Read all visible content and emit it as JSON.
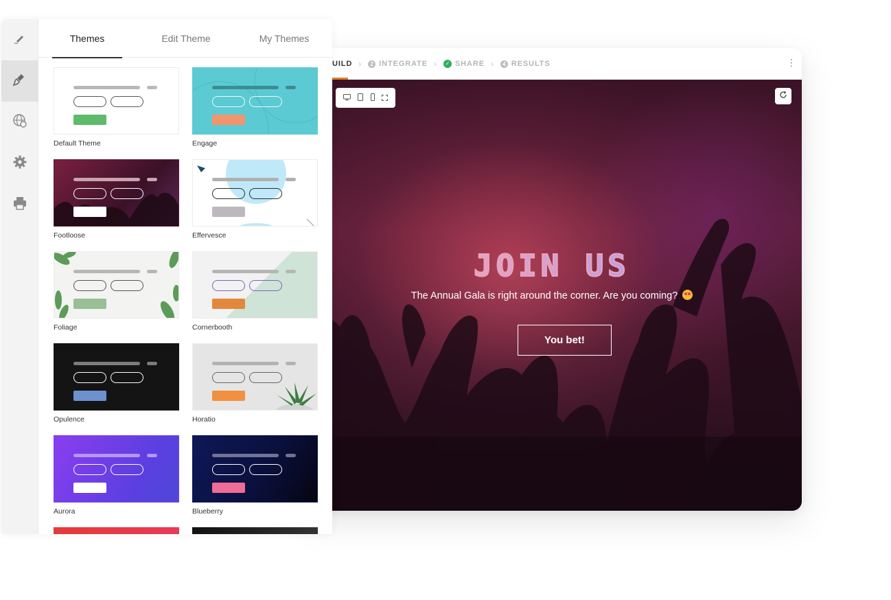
{
  "tabs": [
    {
      "label": "Themes",
      "active": true
    },
    {
      "label": "Edit Theme",
      "active": false
    },
    {
      "label": "My Themes",
      "active": false
    }
  ],
  "rail": [
    {
      "icon": "pen-icon"
    },
    {
      "icon": "paint-brush-icon",
      "active": true
    },
    {
      "icon": "globe-icon"
    },
    {
      "icon": "gear-icon"
    },
    {
      "icon": "printer-icon"
    }
  ],
  "themes": [
    {
      "name": "Default Theme",
      "bg": "#ffffff",
      "bar": "#b8b8b8",
      "pill": "#555555",
      "btn": "#5dbb6b"
    },
    {
      "name": "Engage",
      "bg": "#5ccad3",
      "bar": "#3f8b93",
      "pill": "#eafafa",
      "btn": "#f2956d"
    },
    {
      "name": "Footloose",
      "bg": "#5b1c34",
      "bar": "#c9a3ae",
      "pill": "#ffffff",
      "btn": "#ffffff"
    },
    {
      "name": "Effervesce",
      "bg": "#ffffff",
      "bar": "#b0b0b0",
      "pill": "#2a2a2a",
      "btn": "#bdb8be"
    },
    {
      "name": "Foliage",
      "bg": "#f3f3f1",
      "bar": "#b6b6b6",
      "pill": "#555555",
      "btn": "#98bf98"
    },
    {
      "name": "Cornerbooth",
      "bg": "#e8ece9",
      "bar": "#b5b5b5",
      "pill": "#7b66b3",
      "btn": "#e2883c"
    },
    {
      "name": "Opulence",
      "bg": "#141414",
      "bar": "#7c7c7c",
      "pill": "#ffffff",
      "btn": "#6d91ce"
    },
    {
      "name": "Horatio",
      "bg": "#e5e5e5",
      "bar": "#b2b2b2",
      "pill": "#666666",
      "btn": "#f29042"
    },
    {
      "name": "Aurora",
      "bg": "#7a3fe8",
      "bar": "#b696f2",
      "pill": "#ffffff",
      "btn": "#ffffff"
    },
    {
      "name": "Blueberry",
      "bg": "#0e1752",
      "bar": "#6f7496",
      "pill": "#ffffff",
      "btn": "#ee6d97"
    }
  ],
  "steps": {
    "build": "UILD",
    "integrate": "INTEGRATE",
    "integrate_num": "2",
    "share": "SHARE",
    "results": "RESULTS",
    "results_num": "4"
  },
  "preview": {
    "title": "JOIN US",
    "subtitle": "The Annual Gala is right around the corner. Are you coming?",
    "cta": "You bet!",
    "accent": "#e07f2f"
  }
}
